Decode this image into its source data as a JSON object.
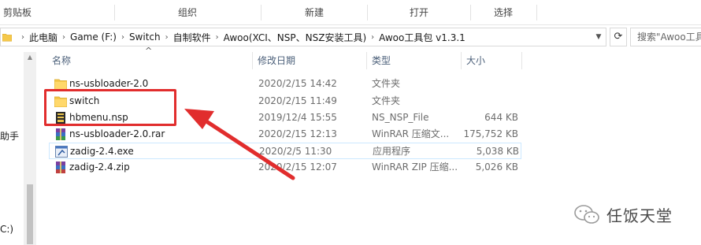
{
  "ribbon": {
    "groups": [
      "剪贴板",
      "组织",
      "新建",
      "打开",
      "选择"
    ]
  },
  "address": {
    "crumbs": [
      "此电脑",
      "Game (F:)",
      "Switch",
      "自制软件",
      "Awoo(XCI、NSP、NSZ安装工具)",
      "Awoo工具包 v1.3.1"
    ],
    "separator": "›",
    "search_placeholder": "搜索\"Awoo工具",
    "refresh_icon": "refresh-icon"
  },
  "nav": {
    "partial_labels": [
      "助手",
      "C:)"
    ]
  },
  "columns": {
    "name": "名称",
    "date": "修改日期",
    "type": "类型",
    "size": "大小"
  },
  "files": [
    {
      "name": "ns-usbloader-2.0",
      "date": "2020/2/15 14:42",
      "type": "文件夹",
      "size": "",
      "icon": "folder-icon"
    },
    {
      "name": "switch",
      "date": "2020/2/15 11:49",
      "type": "文件夹",
      "size": "",
      "icon": "folder-icon"
    },
    {
      "name": "hbmenu.nsp",
      "date": "2019/12/4 15:55",
      "type": "NS_NSP_File",
      "size": "644 KB",
      "icon": "nsp-file-icon"
    },
    {
      "name": "ns-usbloader-2.0.rar",
      "date": "2020/2/15 12:13",
      "type": "WinRAR 压缩文...",
      "size": "175,752 KB",
      "icon": "winrar-archive-icon"
    },
    {
      "name": "zadig-2.4.exe",
      "date": "2020/2/5 11:30",
      "type": "应用程序",
      "size": "5,038 KB",
      "icon": "exe-app-icon"
    },
    {
      "name": "zadig-2.4.zip",
      "date": "2020/2/15 12:07",
      "type": "WinRAR ZIP 压缩...",
      "size": "5,026 KB",
      "icon": "winrar-zip-icon"
    }
  ],
  "colors": {
    "annotation_red": "#e12d2d",
    "folder_yellow": "#f5c84a",
    "selection_border": "#cce8ff",
    "header_text": "#4c607a"
  },
  "watermark": {
    "text": "任饭天堂",
    "icon": "wechat-icon"
  }
}
